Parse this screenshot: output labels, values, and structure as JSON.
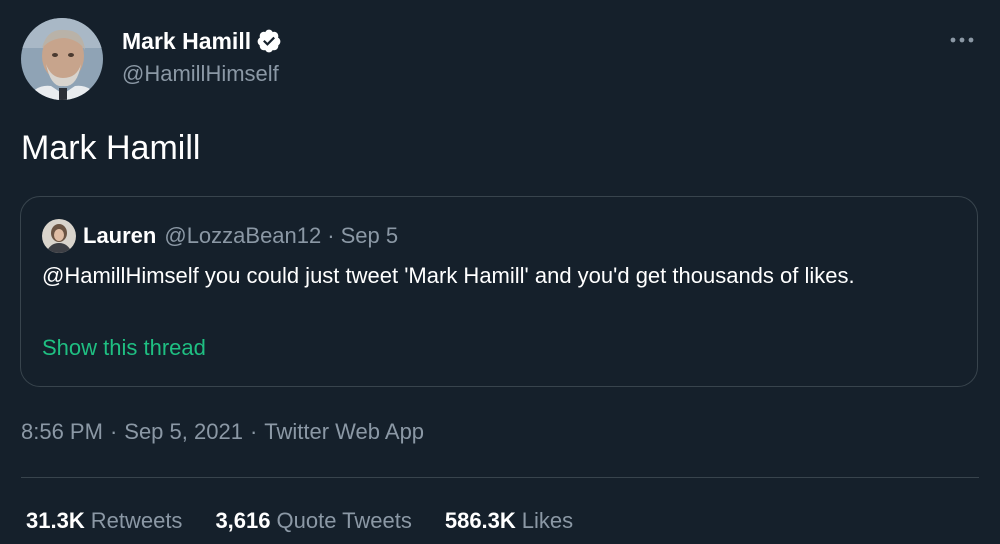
{
  "author": {
    "name": "Mark Hamill",
    "handle": "@HamillHimself",
    "avatar_icon": "avatar-icon",
    "verified_icon": "verified-badge-icon"
  },
  "more_icon": "more-options-icon",
  "tweet_text": "Mark Hamill",
  "quoted_tweet": {
    "name": "Lauren",
    "handle": "@LozzaBean12",
    "separator": "·",
    "date": "Sep 5",
    "text": "@HamillHimself you could just tweet 'Mark Hamill' and you'd get thousands of likes.",
    "thread_link": "Show this thread"
  },
  "meta": {
    "time": "8:56 PM",
    "separator": "·",
    "date": "Sep 5, 2021",
    "source": "Twitter Web App"
  },
  "stats": {
    "retweets_count": "31.3K",
    "retweets_label": "Retweets",
    "quotes_count": "3,616",
    "quotes_label": "Quote Tweets",
    "likes_count": "586.3K",
    "likes_label": "Likes"
  },
  "colors": {
    "background": "#15202b",
    "text": "#ffffff",
    "secondary_text": "#8b98a5",
    "border": "#38444d",
    "link": "#1fbf82",
    "verified": "#ffffff"
  }
}
